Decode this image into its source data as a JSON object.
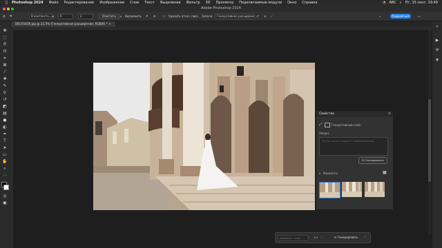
{
  "menubar": {
    "apple_icon": "apple-icon",
    "app": "Photoshop 2024",
    "items": [
      "Файл",
      "Редактирование",
      "Изображение",
      "Слои",
      "Текст",
      "Выделение",
      "Фильтр",
      "3D",
      "Просмотр",
      "Подключаемые модули",
      "Окно",
      "Справка"
    ],
    "keyboard": "ABC",
    "clock": "Пт, 15 сент. 19:49"
  },
  "window": {
    "title": "Adobe Photoshop 2024"
  },
  "options": {
    "tool_icon": "lasso-icon",
    "mode_select": "В контекстн...",
    "feather_value": "0",
    "gap_value": "2",
    "clear_button": "Очистить",
    "straighten_button": "Выпрямить",
    "remove_label": "Удалить отсеч. пикс.",
    "fill_label": "Заполн:",
    "fill_select": "Генеративное расширение",
    "share_button": "Поделиться"
  },
  "document": {
    "tab": "DSC05436.jpg @ 22,5% (Генеративное расширение, RGB/8) *"
  },
  "properties": {
    "tab": "Свойства",
    "layer_label": "Генеративный слой",
    "prompt_label": "Запрос",
    "prompt_placeholder": "Что вы хотите создать? (Необязательно)",
    "generate_button": "Генерировать",
    "variants_label": "Варианты"
  },
  "context_bar": {
    "input_placeholder": "Добавить запр...",
    "page": "1/3",
    "generate_button": "Генерировать"
  },
  "colors": {
    "accent": "#2680eb",
    "panel_bg": "#323232",
    "app_bg": "#1e1e1e"
  }
}
